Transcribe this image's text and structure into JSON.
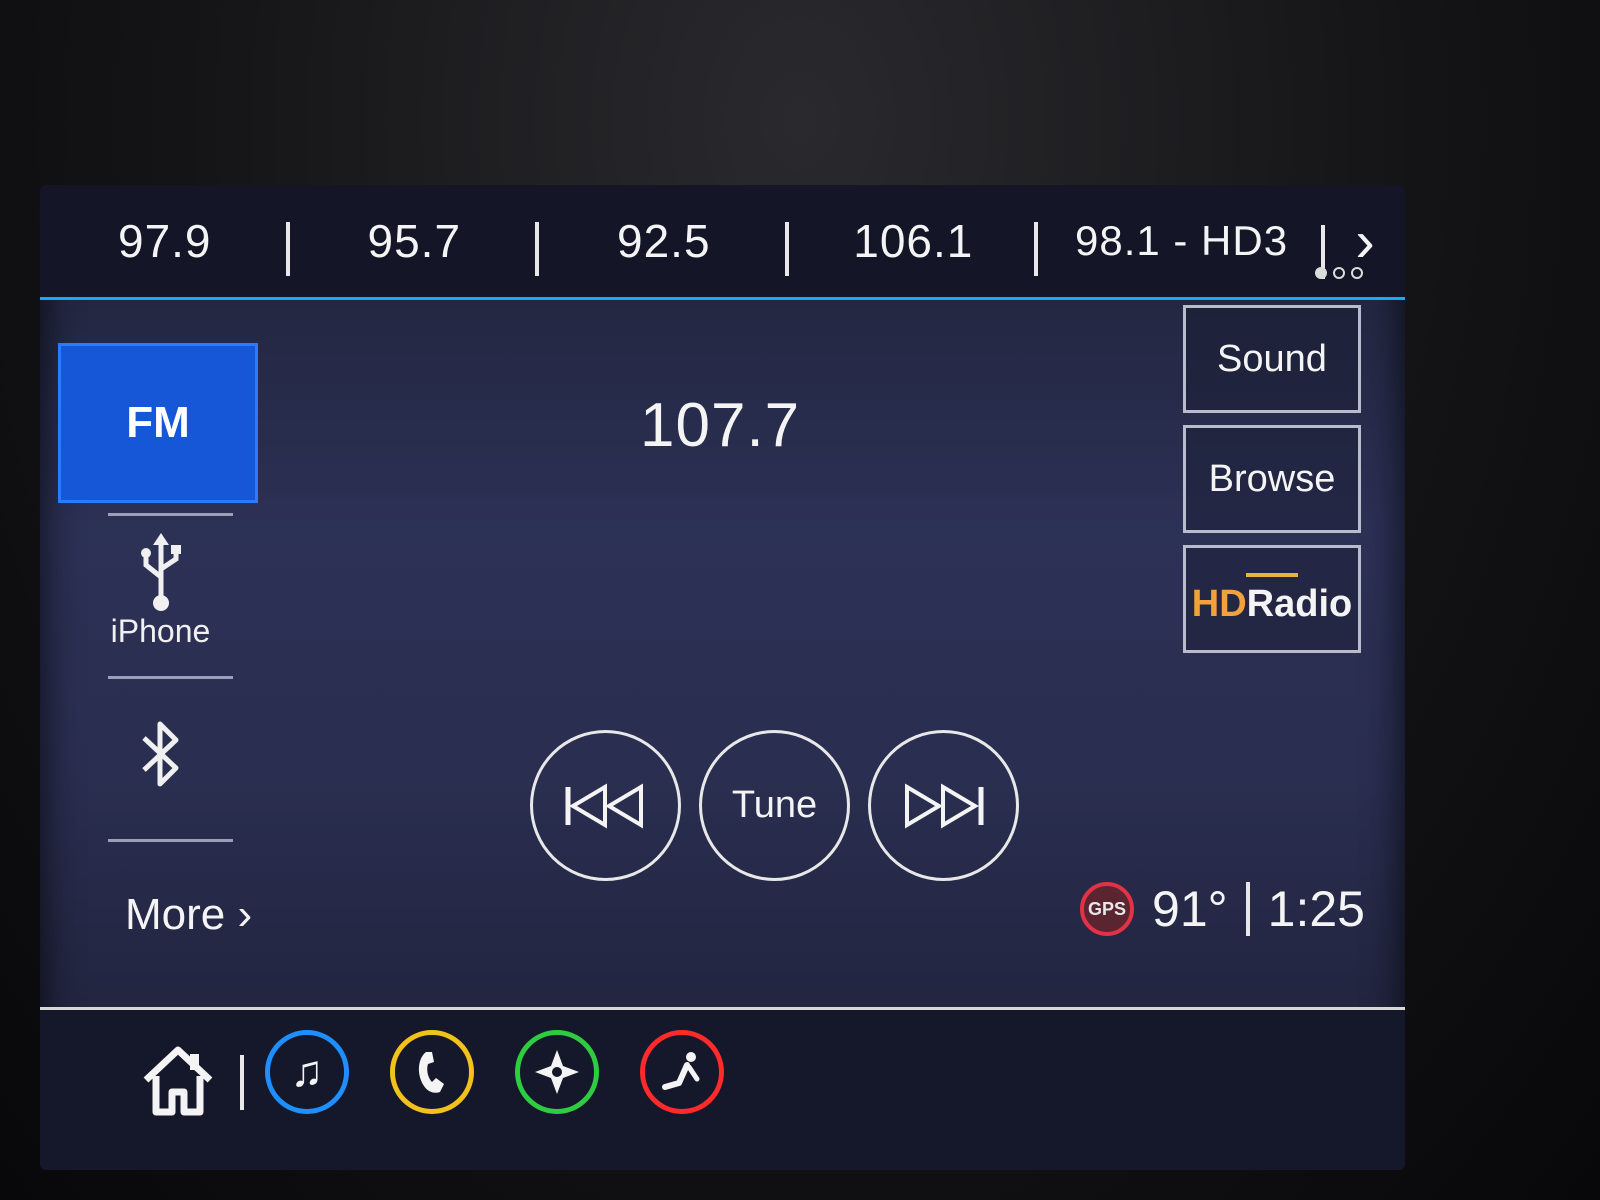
{
  "presets": [
    {
      "label": "97.9"
    },
    {
      "label": "95.7"
    },
    {
      "label": "92.5"
    },
    {
      "label": "106.1"
    },
    {
      "label": "98.1 - HD3"
    }
  ],
  "presets_next_icon": "chevron-right-icon",
  "sources": {
    "fm_label": "FM",
    "usb_label": "iPhone",
    "more_label": "More ›"
  },
  "main": {
    "station": "107.7",
    "sound_label": "Sound",
    "browse_label": "Browse",
    "hd_prefix": "HD",
    "hd_suffix": "Radio",
    "tune_label": "Tune"
  },
  "status": {
    "gps_label": "GPS",
    "temperature": "91°",
    "time": "1:25"
  },
  "colors": {
    "accent": "#19a7ff",
    "fm_active": "#1557d6",
    "audio_ring": "#1e8fff",
    "phone_ring": "#f2c21a",
    "nav_ring": "#2ecc40",
    "seat_ring": "#ff2a2a",
    "gps_red": "#e23245",
    "hd_orange": "#f2a23a"
  },
  "bottom_nav": {
    "home_icon": "home-icon",
    "audio_icon": "music-note-icon",
    "phone_icon": "phone-icon",
    "nav_icon": "compass-icon",
    "seat_icon": "seat-icon"
  }
}
